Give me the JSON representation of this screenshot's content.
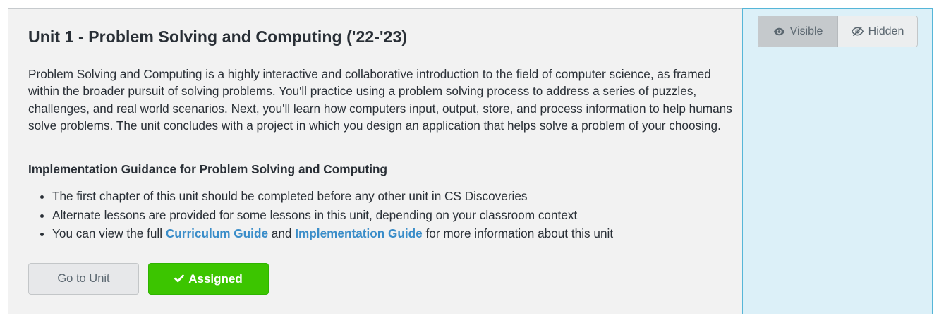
{
  "unit": {
    "title": "Unit 1 - Problem Solving and Computing ('22-'23)",
    "description": "Problem Solving and Computing is a highly interactive and collaborative introduction to the field of computer science, as framed within the broader pursuit of solving problems. You'll practice using a problem solving process to address a series of puzzles, challenges, and real world scenarios. Next, you'll learn how computers input, output, store, and process information to help humans solve problems. The unit concludes with a project in which you design an application that helps solve a problem of your choosing."
  },
  "guidance": {
    "heading": "Implementation Guidance for Problem Solving and Computing",
    "items": [
      "The first chapter of this unit should be completed before any other unit in CS Discoveries",
      "Alternate lessons are provided for some lessons in this unit, depending on your classroom context"
    ],
    "item3": {
      "prefix": "You can view the full ",
      "link1": "Curriculum Guide",
      "middle": " and ",
      "link2": "Implementation Guide",
      "suffix": " for more information about this unit"
    }
  },
  "actions": {
    "go_to_unit": "Go to Unit",
    "assigned": "Assigned"
  },
  "visibility": {
    "visible_label": "Visible",
    "hidden_label": "Hidden",
    "selected": "Visible"
  },
  "icons": {
    "assigned": "check-icon",
    "visible": "eye-icon",
    "hidden": "eye-slash-icon"
  },
  "colors": {
    "link": "#3a8dc9",
    "assigned_green": "#3cc500",
    "side_panel_bg": "#dcf0f8",
    "side_panel_border": "#56b6d8",
    "card_bg": "#f2f2f2"
  }
}
